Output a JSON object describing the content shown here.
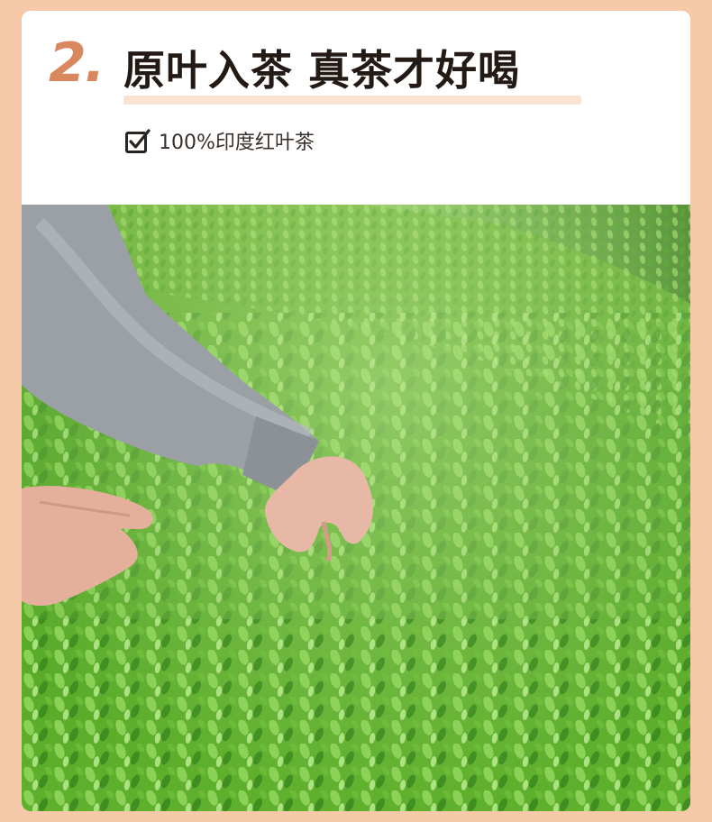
{
  "section": {
    "number": "2.",
    "title": "原叶入茶 真茶才好喝",
    "feature_icon": "checkbox-checked-icon",
    "feature_label": "100%印度红叶茶"
  },
  "photo": {
    "subject": "tea-field-hand-picking"
  },
  "colors": {
    "page_background": "#f6c9a8",
    "accent": "#d9875e",
    "title_text": "#231a15",
    "highlight": "#fbe3d2"
  }
}
